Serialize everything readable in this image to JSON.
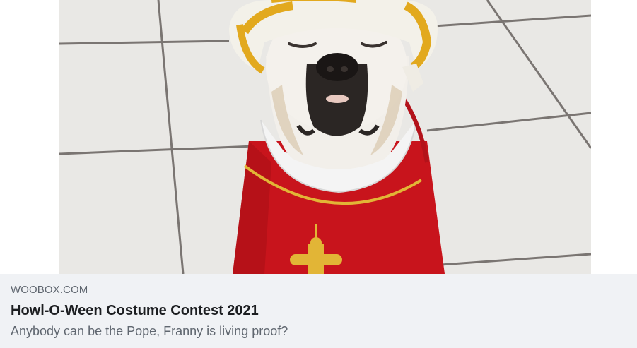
{
  "link_preview": {
    "image_subject": "dog-in-pope-costume",
    "domain": "WOOBOX.COM",
    "title": "Howl-O-Ween Costume Contest 2021",
    "description": "Anybody can be the Pope, Franny is living proof?"
  },
  "colors": {
    "footer_bg": "#f0f2f5",
    "domain_text": "#606770",
    "title_text": "#1c1e21",
    "robe_red": "#c8141c",
    "gold_trim": "#e2b536"
  }
}
